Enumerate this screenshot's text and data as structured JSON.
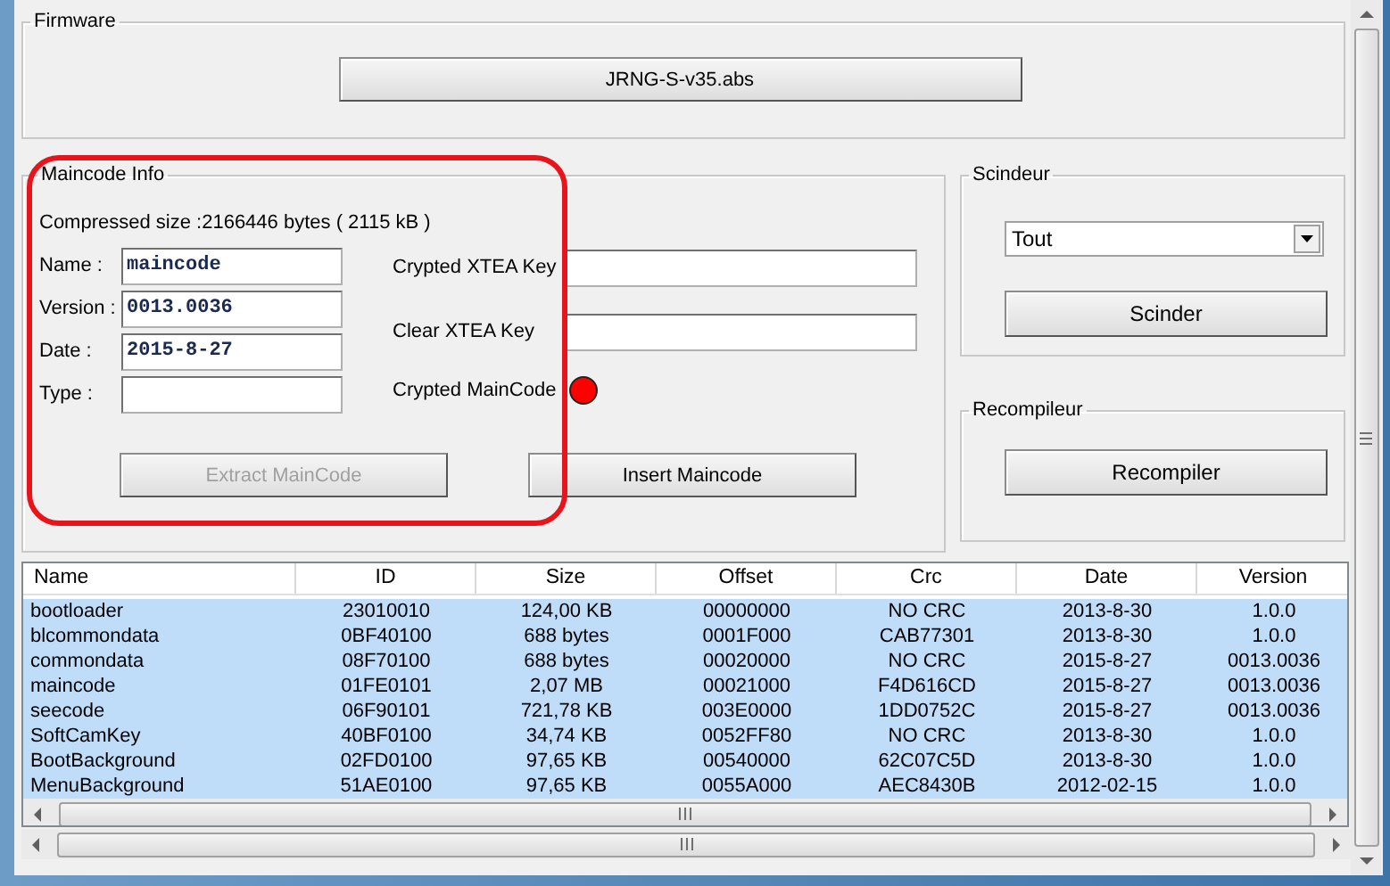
{
  "firmware": {
    "title": "Firmware",
    "file_button": "JRNG-S-v35.abs"
  },
  "maincode_info": {
    "title": "Maincode Info",
    "compressed_size": "Compressed size :2166446 bytes ( 2115 kB )",
    "fields": [
      {
        "label": "Name :",
        "value": "maincode"
      },
      {
        "label": "Version :",
        "value": "0013.0036"
      },
      {
        "label": "Date :",
        "value": "2015-8-27"
      },
      {
        "label": "Type :"
      }
    ],
    "key_fields": [
      {
        "label": "Crypted XTEA Key"
      },
      {
        "label": "Clear XTEA Key"
      }
    ],
    "crypted_maincode": {
      "label": "Crypted MainCode",
      "on": false
    },
    "buttons": [
      {
        "label": "Extract MainCode",
        "disabled": true
      },
      {
        "label": "Insert Maincode",
        "disabled": false
      }
    ]
  },
  "scindeur": {
    "title": "Scindeur",
    "select": {
      "value": "Tout"
    },
    "button": "Scinder"
  },
  "recompileur": {
    "title": "Recompileur",
    "button": "Recompiler"
  },
  "table": {
    "columns": [
      "Name",
      "ID",
      "Size",
      "Offset",
      "Crc",
      "Date",
      "Version"
    ],
    "rows": [
      {
        "selected": true,
        "cells": [
          "bootloader",
          "23010010",
          "124,00 KB",
          "00000000",
          "NO CRC",
          "2013-8-30",
          "1.0.0"
        ]
      },
      {
        "selected": true,
        "cells": [
          "blcommondata",
          "0BF40100",
          "688 bytes",
          "0001F000",
          "CAB77301",
          "2013-8-30",
          "1.0.0"
        ]
      },
      {
        "selected": true,
        "cells": [
          "commondata",
          "08F70100",
          "688 bytes",
          "00020000",
          "NO CRC",
          "2015-8-27",
          "0013.0036"
        ]
      },
      {
        "selected": true,
        "cells": [
          "maincode",
          "01FE0101",
          "2,07 MB",
          "00021000",
          "F4D616CD",
          "2015-8-27",
          "0013.0036"
        ]
      },
      {
        "selected": true,
        "cells": [
          "seecode",
          "06F90101",
          "721,78 KB",
          "003E0000",
          "1DD0752C",
          "2015-8-27",
          "0013.0036"
        ]
      },
      {
        "selected": true,
        "cells": [
          "SoftCamKey",
          "40BF0100",
          "34,74 KB",
          "0052FF80",
          "NO CRC",
          "2013-8-30",
          "1.0.0"
        ]
      },
      {
        "selected": true,
        "cells": [
          "BootBackground",
          "02FD0100",
          "97,65 KB",
          "00540000",
          "62C07C5D",
          "2013-8-30",
          "1.0.0"
        ]
      },
      {
        "selected": true,
        "cells": [
          "MenuBackground",
          "51AE0100",
          "97,65 KB",
          "0055A000",
          "AEC8430B",
          "2012-02-15",
          "1.0.0"
        ]
      }
    ]
  }
}
